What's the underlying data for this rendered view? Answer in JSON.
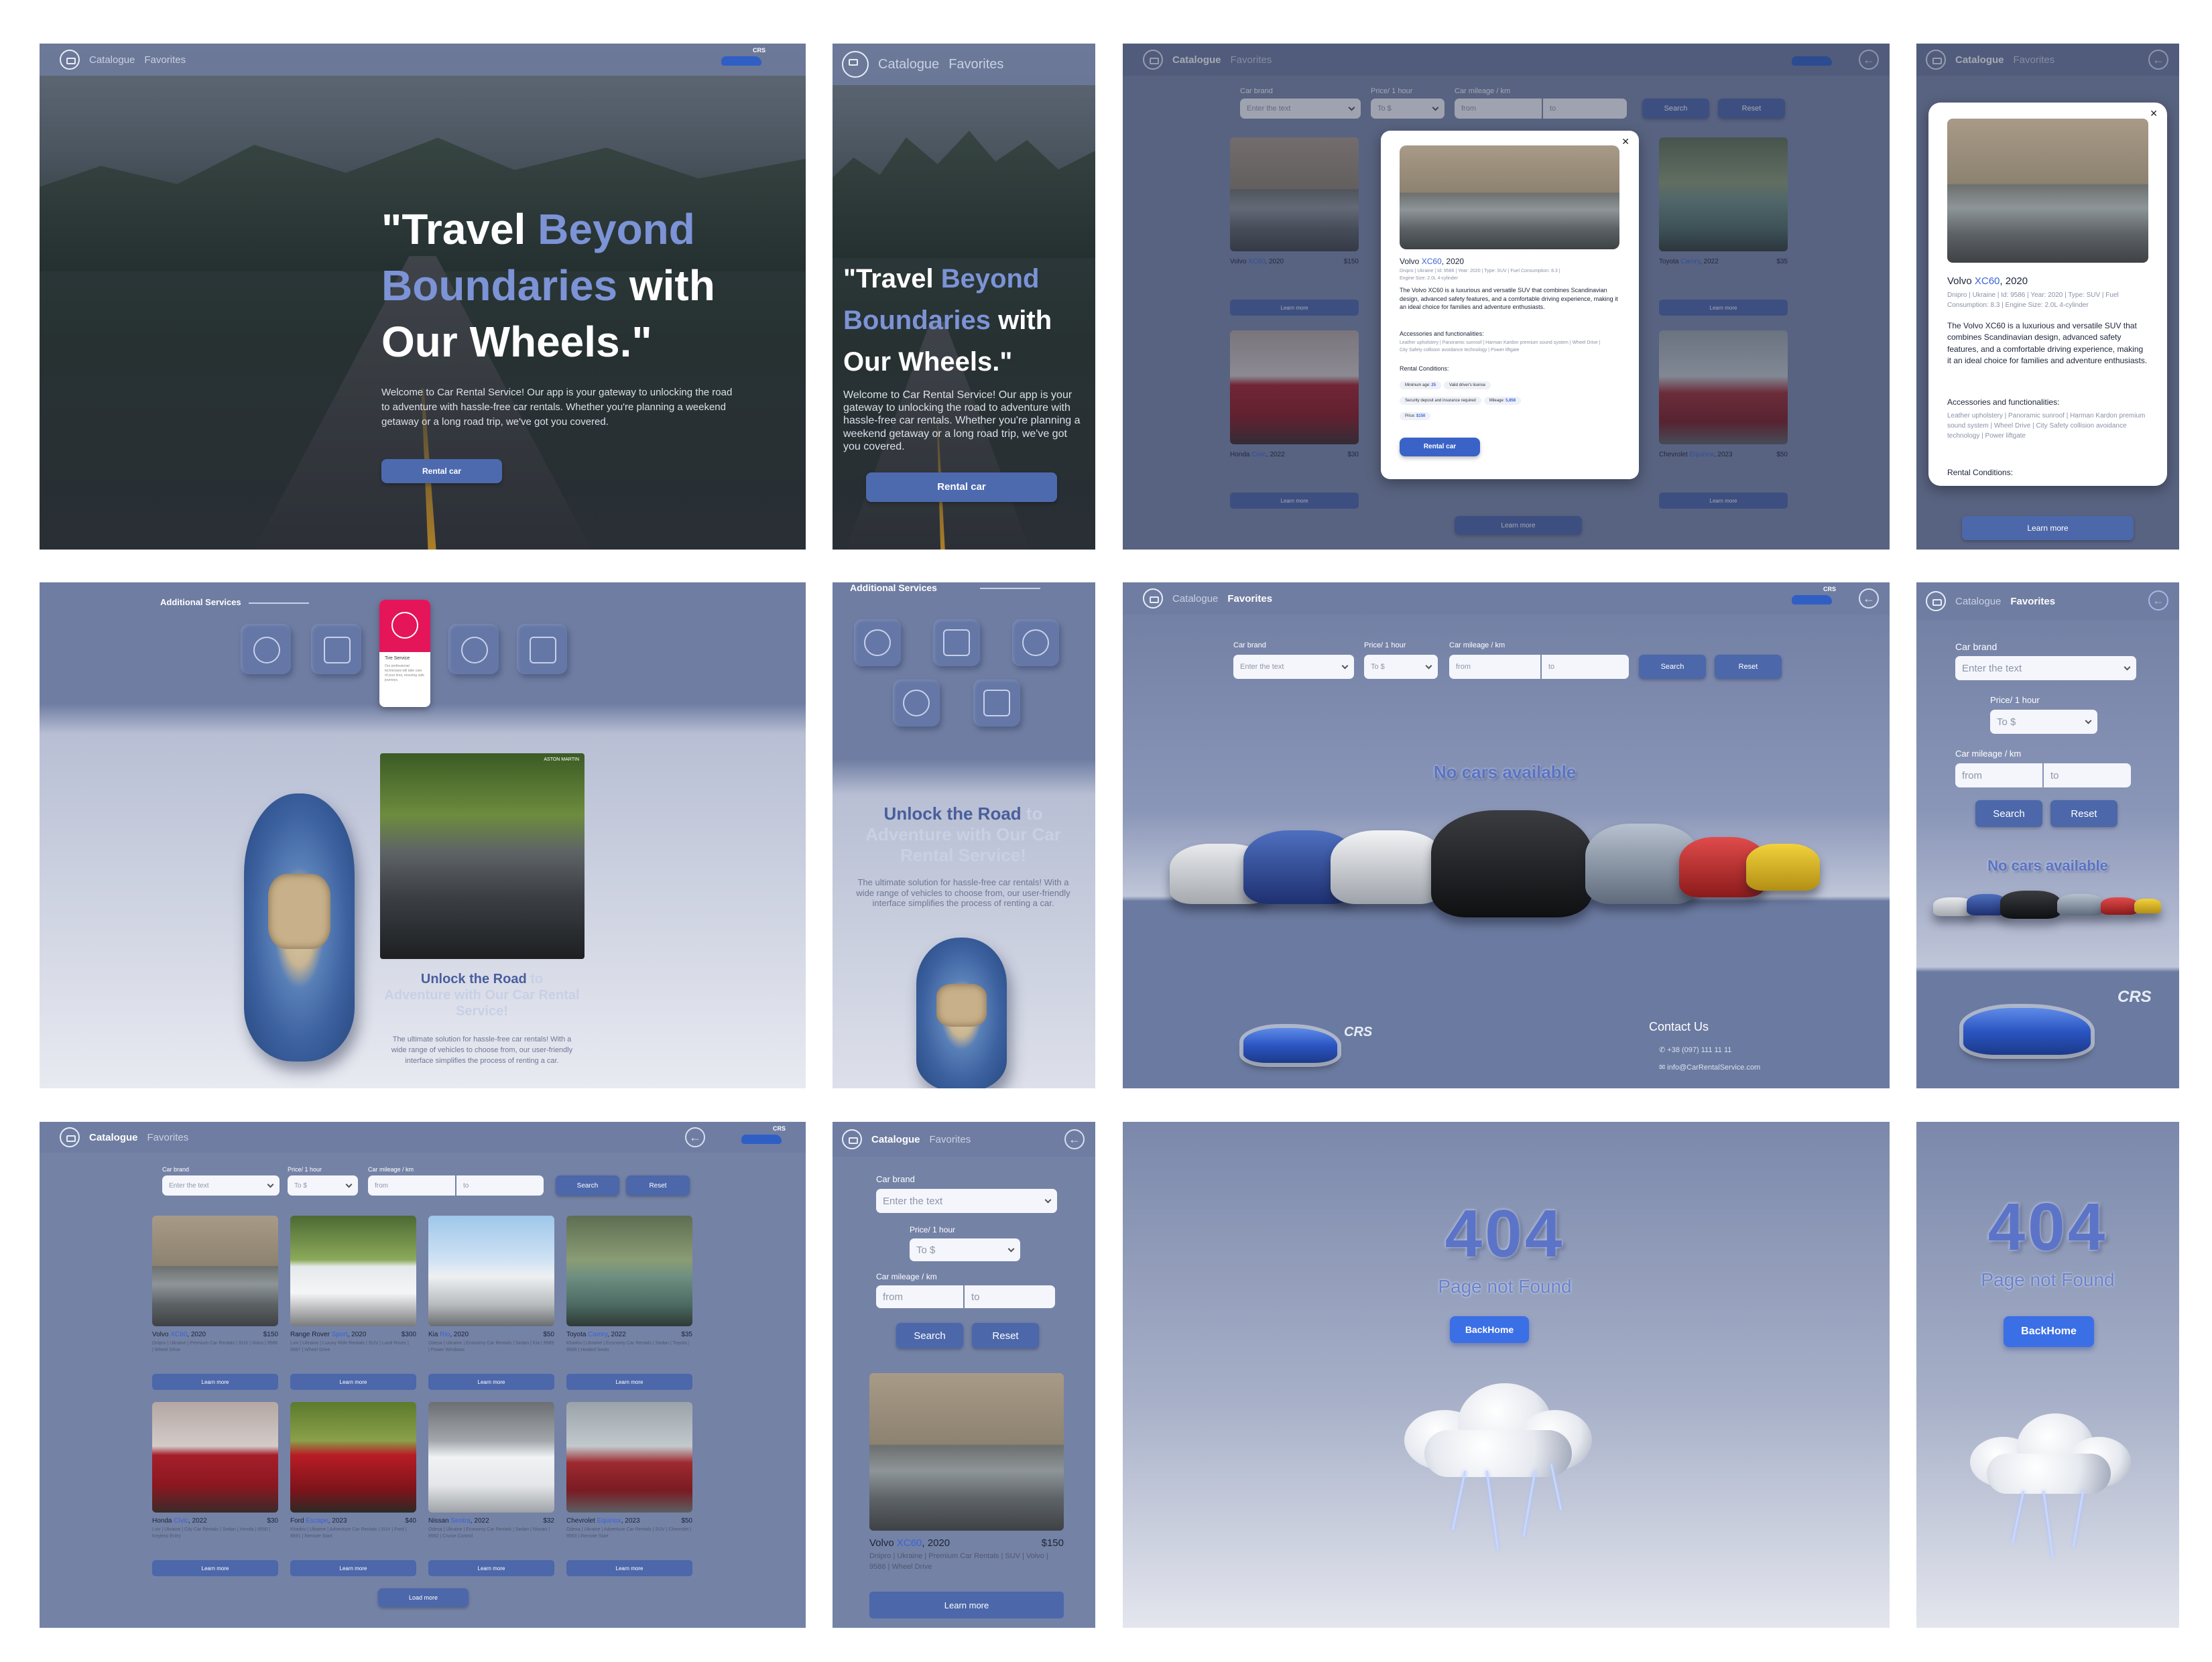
{
  "nav": {
    "catalogue": "Catalogue",
    "favorites": "Favorites",
    "logo_text": "CRS"
  },
  "hero": {
    "title_1": "\"Travel ",
    "title_hl1": "Beyond",
    "title_hl2": "Boundaries",
    "title_2": " with",
    "title_3": "Our Wheels.\"",
    "text": "Welcome to Car Rental Service! Our app is your gateway to unlocking the road to adventure with hassle-free car rentals. Whether you're planning a weekend getaway or a long road trip, we've got you covered.",
    "button": "Rental car"
  },
  "filters": {
    "brand_label": "Car brand",
    "brand_placeholder": "Enter the text",
    "price_label": "Price/ 1 hour",
    "price_label_alt": "Price/ 1 hour",
    "price_placeholder": "To $",
    "mileage_label": "Car mileage / km",
    "from_placeholder": "from",
    "to_placeholder": "to",
    "search": "Search",
    "reset": "Reset"
  },
  "cars": [
    {
      "brand": "Volvo ",
      "model": "XC60",
      "year": ", 2020",
      "price": "$150",
      "tags": "Dnipro | Ukraine | Premium Car Rentals | SUV | Volvo | 9586 | Wheel Drive"
    },
    {
      "brand": "Range Rover ",
      "model": "Sport",
      "year": ", 2020",
      "price": "$300",
      "tags": "Lviv | Ukraine | Luxury Ride Rentals | SUV | Land Rover | 9587 | Wheel Drive"
    },
    {
      "brand": "Kia ",
      "model": "Rio",
      "year": ", 2020",
      "price": "$50",
      "tags": "Odesa | Ukraine | Economy Car Rentals | Sedan | Kia | 9589 | Power Windows"
    },
    {
      "brand": "Toyota ",
      "model": "Camry",
      "year": ", 2022",
      "price": "$35",
      "tags": "Kharkiv | Ukraine | Economy Car Rentals | Sedan | Toyota | 9589 | Heated Seats"
    },
    {
      "brand": "Honda ",
      "model": "Civic",
      "year": ", 2022",
      "price": "$30",
      "tags": "Lviv | Ukraine | City Car Rentals | Sedan | Honda | 9590 | Keyless Entry"
    },
    {
      "brand": "Ford ",
      "model": "Escape",
      "year": ", 2023",
      "price": "$40",
      "tags": "Kharkiv | Ukraine | Adventure Car Rentals | SUV | Ford | 9591 | Remote Start"
    },
    {
      "brand": "Nissan ",
      "model": "Sentra",
      "year": ", 2022",
      "price": "$32",
      "tags": "Odesa | Ukraine | Economy Car Rentals | Sedan | Nissan | 9592 | Cruise Control"
    },
    {
      "brand": "Chevrolet ",
      "model": "Equinox",
      "year": ", 2023",
      "price": "$50",
      "tags": "Odesa | Ukraine | Adventure Car Rentals | SUV | Chevrolet | 9593 | Remote Start"
    }
  ],
  "learn_more": "Learn more",
  "load_more": "Load more",
  "modal": {
    "brand": "Volvo ",
    "model": "XC60",
    "year": ", 2020",
    "specs": "Dnipro | Ukraine | Id: 9586 | Year: 2020 | Type: SUV | Fuel Consumption: 8.3 | Engine Size: 2.0L 4-cylinder",
    "description": "The Volvo XC60 is a luxurious and versatile SUV that combines Scandinavian design, advanced safety features, and a comfortable driving experience, making it an ideal choice for families and adventure enthusiasts.",
    "accessories_title": "Accessories and functionalities:",
    "accessories": "Leather upholstery | Panoramic sunroof | Harman Kardon premium sound system | Wheel Drive | City Safety collision avoidance technology | Power liftgate",
    "conditions_title": "Rental Conditions:",
    "cond_age_label": "Minimum age: ",
    "cond_age_value": "25",
    "cond_license": "Valid driver's license",
    "cond_deposit": "Security deposit and insurance required",
    "cond_mileage_label": "Mileage: ",
    "cond_mileage_value": "5,858",
    "cond_price_label": "Price: ",
    "cond_price_value": "$150",
    "button": "Rental car"
  },
  "services": {
    "title": "Additional Services",
    "tooltip_title": "Tire Service",
    "tooltip_text": "Our professional technicians will take care of your tires, ensuring safe journeys."
  },
  "unlock": {
    "hl": "Unlock the Road",
    "lt1": " to",
    "rest": "Adventure with Our Car Rental Service!",
    "text": "The ultimate solution for hassle-free car rentals! With a wide range of vehicles to choose from, our user-friendly interface simplifies the process of renting a car.",
    "photo_badge": "ASTON MARTIN"
  },
  "empty": {
    "text": "No cars available"
  },
  "footer": {
    "contact": "Contact Us",
    "phone": "+38 (097) 111 11 11",
    "email": "info@CarRentalService.com"
  },
  "notfound": {
    "code": "404",
    "text": "Page not Found",
    "button": "BackHome"
  }
}
